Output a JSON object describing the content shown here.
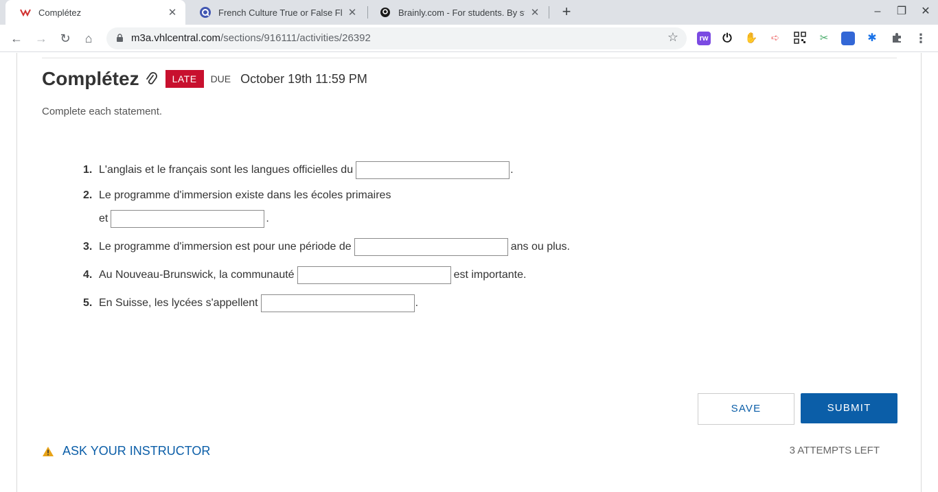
{
  "browser": {
    "tabs": [
      {
        "title": "Complétez",
        "active": true,
        "favicon": "vhl-icon"
      },
      {
        "title": "French Culture True or False Flas",
        "active": false,
        "favicon": "quizlet-icon"
      },
      {
        "title": "Brainly.com - For students. By stu",
        "active": false,
        "favicon": "brainly-icon"
      }
    ],
    "url_host": "m3a.vhlcentral.com",
    "url_path": "/sections/916111/activities/26392"
  },
  "activity": {
    "title": "Complétez",
    "late_badge": "LATE",
    "due_label": "DUE",
    "due_date": "October 19th 11:59 PM",
    "instructions": "Complete each statement."
  },
  "questions": [
    {
      "num": "1.",
      "before": "L'anglais et le français sont les langues officielles du",
      "after": ".",
      "value": ""
    },
    {
      "num": "2.",
      "before": "Le programme d'immersion existe dans les écoles primaires",
      "line2_before": "et",
      "after": ".",
      "value": ""
    },
    {
      "num": "3.",
      "before": "Le programme d'immersion est pour une période de",
      "after": "ans ou plus.",
      "value": ""
    },
    {
      "num": "4.",
      "before": "Au Nouveau-Brunswick, la communauté",
      "after": "est importante.",
      "value": ""
    },
    {
      "num": "5.",
      "before": "En Suisse, les lycées s'appellent",
      "after": ".",
      "value": ""
    }
  ],
  "actions": {
    "save": "SAVE",
    "submit": "SUBMIT",
    "ask_instructor": "ASK YOUR INSTRUCTOR",
    "attempts_left": "3 ATTEMPTS LEFT"
  },
  "colors": {
    "accent": "#0b5ea8",
    "late": "#c8102e"
  }
}
